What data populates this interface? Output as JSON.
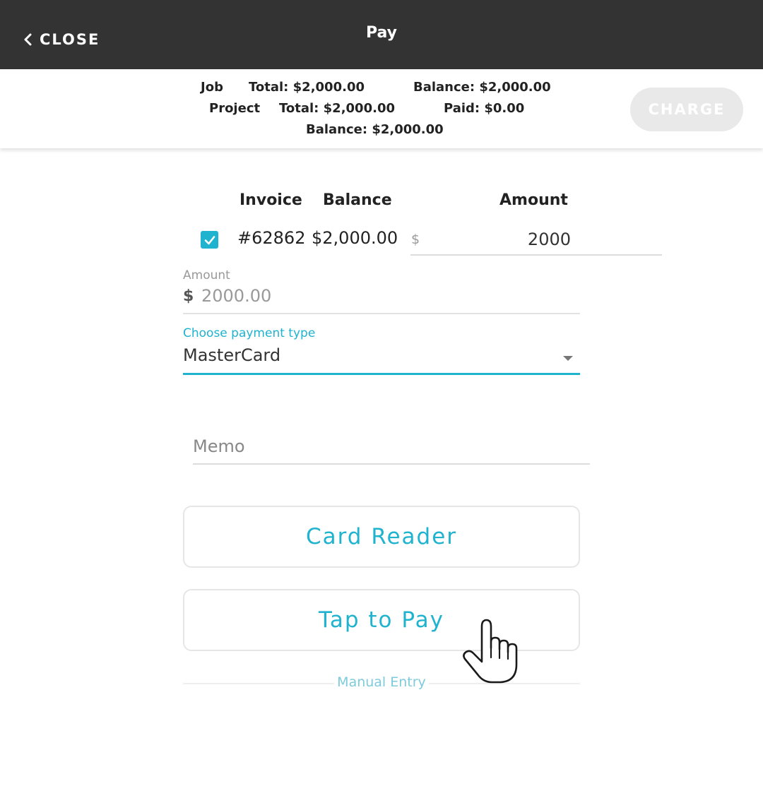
{
  "header": {
    "close_label": "CLOSE",
    "title": "Pay"
  },
  "summary": {
    "job_label": "Job",
    "job_total": "Total: $2,000.00",
    "job_balance": "Balance: $2,000.00",
    "project_label": "Project",
    "project_total": "Total: $2,000.00",
    "project_paid": "Paid: $0.00",
    "project_balance": "Balance: $2,000.00",
    "charge_label": "CHARGE"
  },
  "invoice_table": {
    "headers": [
      "Invoice",
      "Balance",
      "Amount"
    ],
    "rows": [
      {
        "checked": true,
        "invoice": "#62862",
        "balance": "$2,000.00",
        "currency": "$",
        "amount": "2000"
      }
    ]
  },
  "amount_field": {
    "label": "Amount",
    "currency": "$",
    "value": "2000.00"
  },
  "payment_type": {
    "label": "Choose payment type",
    "selected": "MasterCard"
  },
  "memo": {
    "placeholder": "Memo"
  },
  "buttons": {
    "card_reader": "Card Reader",
    "tap_to_pay": "Tap to Pay",
    "manual_entry": "Manual Entry"
  },
  "colors": {
    "accent": "#1fb3cf",
    "header_bg": "#333333",
    "charge_disabled": "#e9e9e9"
  },
  "icons": {
    "back": "chevron-left-icon",
    "check": "checkmark-icon",
    "dropdown": "caret-down-icon",
    "pointer": "hand-pointer-icon"
  }
}
